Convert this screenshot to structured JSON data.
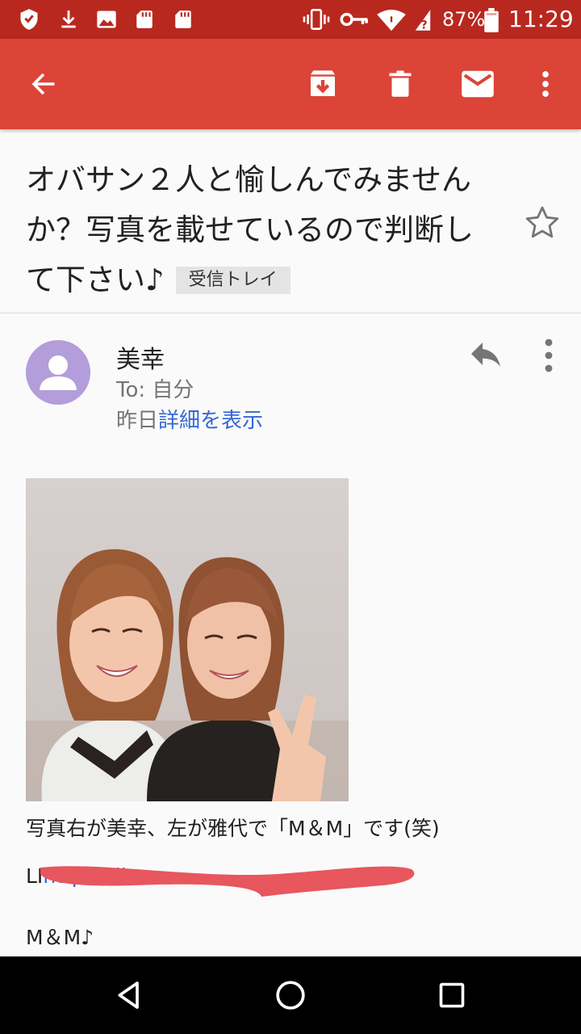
{
  "status_bar": {
    "battery": "87%",
    "time": "11:29",
    "icons": [
      "shield-icon",
      "download-icon",
      "image-icon",
      "sd-card-icon",
      "sd-card-icon",
      "vibrate-icon",
      "key-icon",
      "wifi-icon",
      "unknown-network-icon",
      "battery-icon"
    ]
  },
  "app_bar": {
    "icons": [
      "back-arrow-icon",
      "archive-icon",
      "delete-icon",
      "mail-icon",
      "more-vert-icon"
    ]
  },
  "message": {
    "subject": "オバサン２人と愉しんでみません か？写真を載せているので判断し て下さい♪",
    "label": "受信トレイ",
    "sender": "美幸",
    "recipient": "To: 自分",
    "date": "昨日",
    "details_link": "詳細を表示",
    "body": {
      "caption": "写真右が美幸、左が雅代で「M＆M」です(笑)",
      "link_prefix": "LI",
      "link_text": "https://li",
      "signature": "M＆M♪"
    }
  },
  "colors": {
    "status_bar": "#b9281e",
    "app_bar": "#db4437",
    "link": "#3367d6",
    "avatar": "#b39ddb",
    "redaction": "#e8565e"
  }
}
